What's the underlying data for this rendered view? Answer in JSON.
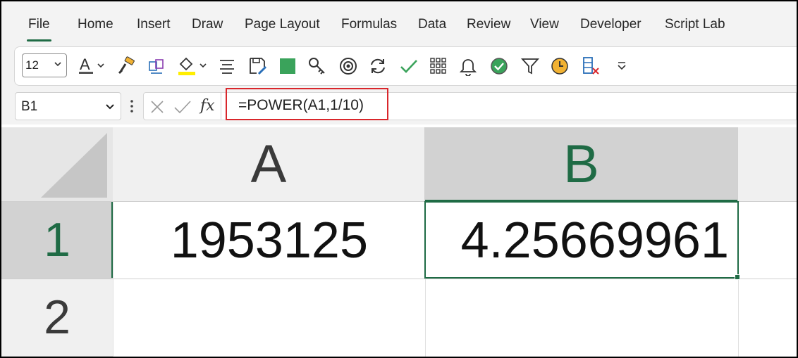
{
  "ribbon": {
    "tabs": [
      {
        "label": "File",
        "active": true
      },
      {
        "label": "Home"
      },
      {
        "label": "Insert"
      },
      {
        "label": "Draw"
      },
      {
        "label": "Page Layout"
      },
      {
        "label": "Formulas"
      },
      {
        "label": "Data"
      },
      {
        "label": "Review"
      },
      {
        "label": "View"
      },
      {
        "label": "Developer"
      },
      {
        "label": "Script Lab"
      }
    ]
  },
  "toolbar": {
    "font_size": "12",
    "icons": [
      "font-color-icon",
      "format-painter-icon",
      "3d-box-icon",
      "fill-color-icon",
      "align-icon",
      "save-as-icon",
      "green-square-icon",
      "key-icon",
      "target-icon",
      "refresh-icon",
      "check-icon",
      "grid-icon",
      "bell-icon",
      "circle-check-icon",
      "filter-icon",
      "clock-icon",
      "delete-column-icon",
      "more-options-icon"
    ],
    "accent_yellow": "#ffee00",
    "accent_green": "#3aa35b"
  },
  "formula_bar": {
    "name_box": "B1",
    "fx_label": "fx",
    "formula": "=POWER(A1,1/10)"
  },
  "sheet": {
    "columns": [
      "A",
      "B"
    ],
    "rows": [
      "1",
      "2"
    ],
    "selected_cell": "B1",
    "cells": {
      "A1": "1953125",
      "B1": "4.25669961"
    },
    "accent": "#1f6b45"
  }
}
